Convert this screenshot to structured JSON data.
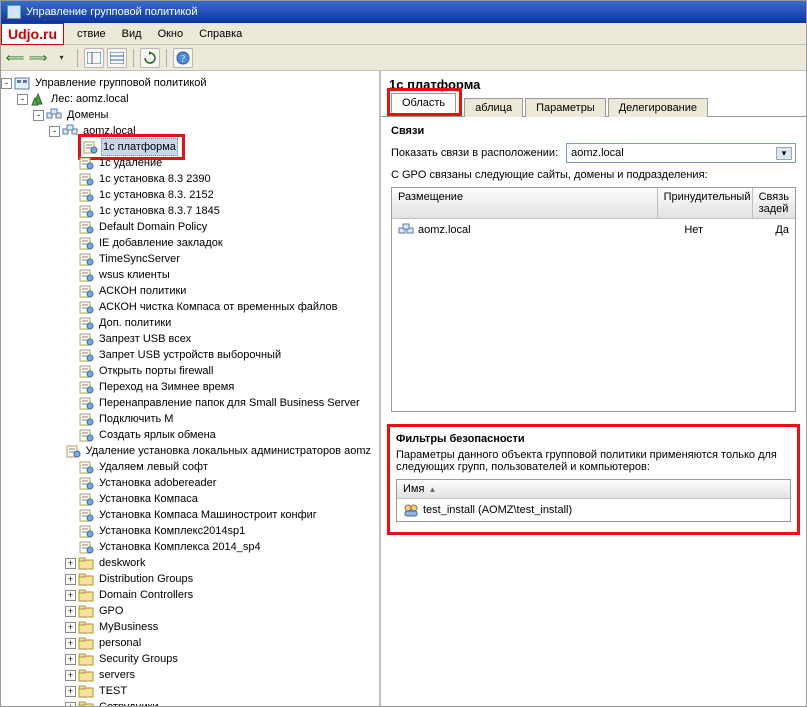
{
  "window": {
    "title": "Управление групповой политикой"
  },
  "logo": "Udjo.ru",
  "menu": {
    "file_suffix": "ствие",
    "view": "Вид",
    "window": "Окно",
    "help": "Справка"
  },
  "tree": {
    "root": "Управление групповой политикой",
    "forest": "Лес: aomz.local",
    "domains": "Домены",
    "domain_selected": "aomz.local",
    "gpos": [
      "1с платформа",
      "1с удаление",
      "1с установка 8.3 2390",
      "1с установка 8.3. 2152",
      "1с установка 8.3.7 1845",
      "Default Domain Policy",
      "IE добавление закладок",
      "TimeSyncServer",
      "wsus клиенты",
      "АСКОН политики",
      "АСКОН чистка Компаса от временных файлов",
      "Доп. политики",
      "Запрезт USB всех",
      "Запрет USB устройств выборочный",
      "Открыть порты firewall",
      "Переход на Зимнее время",
      "Перенаправление папок для Small Business Server",
      "Подключить M",
      "Создать ярлык обмена",
      "Удаление установка локальных администраторов aomz",
      "Удаляем левый софт",
      "Установка adobereader",
      "Установка Компаса",
      "Установка Компаса Машиностроит конфиг",
      "Установка Комплекс2014sp1",
      "Установка Комплекса 2014_sp4"
    ],
    "ous": [
      "deskwork",
      "Distribution Groups",
      "Domain Controllers",
      "GPO",
      "MyBusiness",
      "personal",
      "Security Groups",
      "servers",
      "TEST",
      "Сотрудники"
    ]
  },
  "detail": {
    "title": "1с платформа",
    "tabs": {
      "scope": "Область",
      "details": "аблица",
      "settings": "Параметры",
      "delegation": "Делегирование"
    },
    "links_heading": "Связи",
    "links_label": "Показать связи в расположении:",
    "links_location": "aomz.local",
    "links_desc": "С GPO связаны следующие сайты, домены и подразделения:",
    "grid": {
      "h1": "Размещение",
      "h2": "Принудительный",
      "h3": "Связь задей",
      "r1c1": "aomz.local",
      "r1c2": "Нет",
      "r1c3": "Да"
    },
    "filters": {
      "heading": "Фильтры безопасности",
      "desc": "Параметры данного объекта групповой политики применяются только для следующих групп, пользователей и компьютеров:",
      "col": "Имя",
      "row1": "test_install (AOMZ\\test_install)"
    }
  }
}
